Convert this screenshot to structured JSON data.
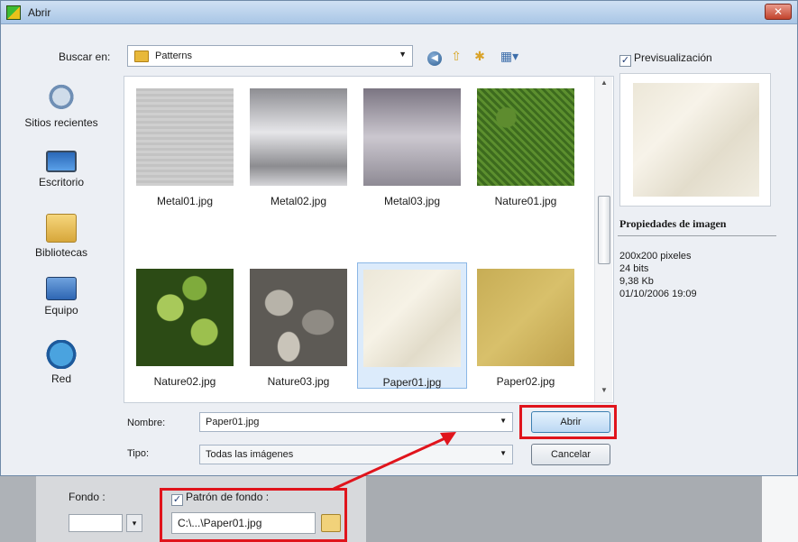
{
  "window": {
    "title": "Abrir",
    "close_symbol": "✕"
  },
  "toolbar": {
    "lookin_label": "Buscar en:",
    "lookin_value": "Patterns",
    "back_symbol": "◀",
    "up_symbol": "⇧",
    "newfolder_symbol": "✱",
    "views_symbol": "▦▾"
  },
  "preview_checkbox": {
    "label": "Previsualización",
    "checked": true
  },
  "places": [
    {
      "label": "Sitios recientes",
      "icon": "recent-places-icon"
    },
    {
      "label": "Escritorio",
      "icon": "desktop-icon"
    },
    {
      "label": "Bibliotecas",
      "icon": "libraries-icon"
    },
    {
      "label": "Equipo",
      "icon": "computer-icon"
    },
    {
      "label": "Red",
      "icon": "network-icon"
    }
  ],
  "files": [
    {
      "name": "Metal01.jpg",
      "selected": false
    },
    {
      "name": "Metal02.jpg",
      "selected": false
    },
    {
      "name": "Metal03.jpg",
      "selected": false
    },
    {
      "name": "Nature01.jpg",
      "selected": false
    },
    {
      "name": "Nature02.jpg",
      "selected": false
    },
    {
      "name": "Nature03.jpg",
      "selected": false
    },
    {
      "name": "Paper01.jpg",
      "selected": true
    },
    {
      "name": "Paper02.jpg",
      "selected": false
    }
  ],
  "properties": {
    "title": "Propiedades de imagen",
    "dimensions": "200x200 pixeles",
    "bits": "24 bits",
    "size": "9,38 Kb",
    "date": "01/10/2006 19:09"
  },
  "form": {
    "name_label": "Nombre:",
    "name_value": "Paper01.jpg",
    "type_label": "Tipo:",
    "type_value": "Todas las imágenes",
    "open_button": "Abrir",
    "cancel_button": "Cancelar"
  },
  "background_panel": {
    "fondo_label": "Fondo :",
    "pattern_label": "Patrón de fondo :",
    "pattern_checked": true,
    "pattern_path": "C:\\...\\Paper01.jpg"
  },
  "colors": {
    "highlight": "#e0141c",
    "selection": "#dcebfb"
  }
}
